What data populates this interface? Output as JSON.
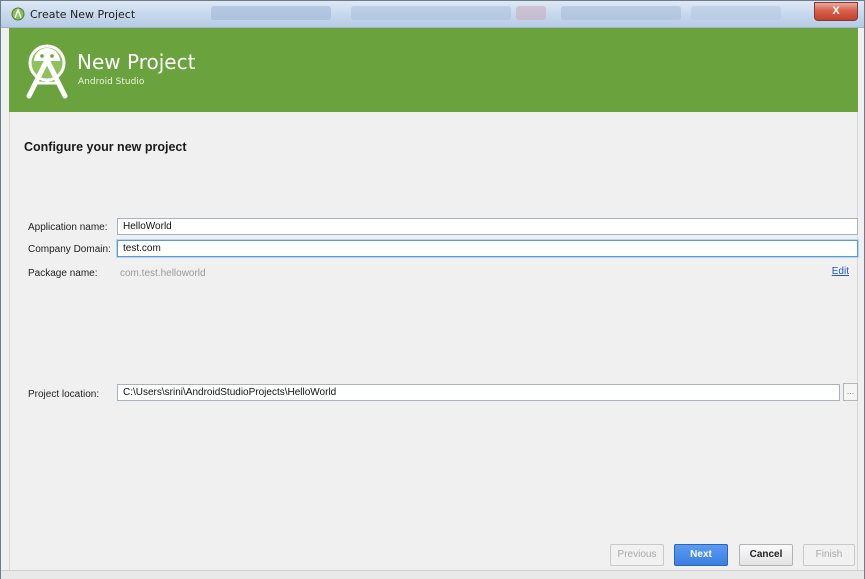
{
  "window": {
    "title": "Create New Project",
    "close_label": "X"
  },
  "header": {
    "title": "New Project",
    "subtitle": "Android Studio"
  },
  "main": {
    "section_title": "Configure your new project",
    "fields": {
      "application_name": {
        "label": "Application name:",
        "value": "HelloWorld"
      },
      "company_domain": {
        "label": "Company Domain:",
        "value": "test.com"
      },
      "package_name": {
        "label": "Package name:",
        "value": "com.test.helloworld",
        "edit_label": "Edit"
      },
      "project_location": {
        "label": "Project location:",
        "value": "C:\\Users\\srini\\AndroidStudioProjects\\HelloWorld",
        "browse_label": "..."
      }
    }
  },
  "footer": {
    "previous_label": "Previous",
    "next_label": "Next",
    "cancel_label": "Cancel",
    "finish_label": "Finish"
  },
  "colors": {
    "header_green": "#6aa33e",
    "primary_blue": "#3b7ee2",
    "link_blue": "#2255c9",
    "close_red": "#c2402c"
  },
  "icons": [
    "android-studio-icon",
    "android-studio-logo",
    "close-icon"
  ]
}
